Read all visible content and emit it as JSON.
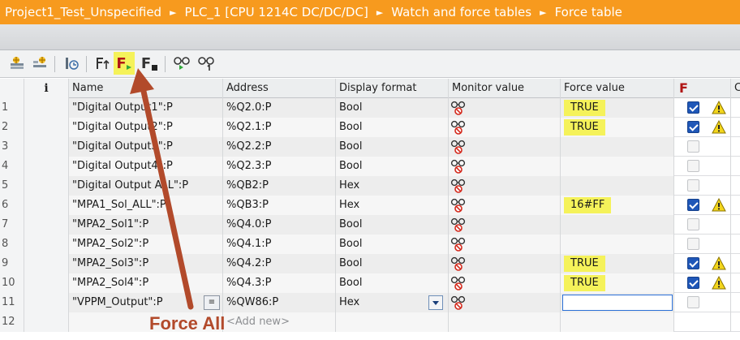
{
  "breadcrumb": [
    "Project1_Test_Unspecified",
    "PLC_1 [CPU 1214C DC/DC/DC]",
    "Watch and force tables",
    "Force table"
  ],
  "breadcrumb_separator": "►",
  "toolbar": {
    "force_once_glyph": "F",
    "stop_force_glyph": "F"
  },
  "columns": {
    "info": "i",
    "name": "Name",
    "address": "Address",
    "display_format": "Display format",
    "monitor_value": "Monitor value",
    "force_value": "Force value",
    "force_flag": "F",
    "extra": "C"
  },
  "rows": [
    {
      "num": "1",
      "name": "\"Digital Output1\":P",
      "address": "%Q2.0:P",
      "format": "Bool",
      "force": "TRUE",
      "checked": true,
      "warn": true
    },
    {
      "num": "2",
      "name": "\"Digital Output2\":P",
      "address": "%Q2.1:P",
      "format": "Bool",
      "force": "TRUE",
      "checked": true,
      "warn": true
    },
    {
      "num": "3",
      "name": "\"Digital Output3\":P",
      "address": "%Q2.2:P",
      "format": "Bool",
      "force": "",
      "checked": false,
      "warn": false
    },
    {
      "num": "4",
      "name": "\"Digital Output4\":P",
      "address": "%Q2.3:P",
      "format": "Bool",
      "force": "",
      "checked": false,
      "warn": false
    },
    {
      "num": "5",
      "name": "\"Digital Output ALL\":P",
      "address": "%QB2:P",
      "format": "Hex",
      "force": "",
      "checked": false,
      "warn": false
    },
    {
      "num": "6",
      "name": "\"MPA1_Sol_ALL\":P",
      "address": "%QB3:P",
      "format": "Hex",
      "force": "16#FF",
      "checked": true,
      "warn": true
    },
    {
      "num": "7",
      "name": "\"MPA2_Sol1\":P",
      "address": "%Q4.0:P",
      "format": "Bool",
      "force": "",
      "checked": false,
      "warn": false
    },
    {
      "num": "8",
      "name": "\"MPA2_Sol2\":P",
      "address": "%Q4.1:P",
      "format": "Bool",
      "force": "",
      "checked": false,
      "warn": false
    },
    {
      "num": "9",
      "name": "\"MPA2_Sol3\":P",
      "address": "%Q4.2:P",
      "format": "Bool",
      "force": "TRUE",
      "checked": true,
      "warn": true
    },
    {
      "num": "10",
      "name": "\"MPA2_Sol4\":P",
      "address": "%Q4.3:P",
      "format": "Bool",
      "force": "TRUE",
      "checked": true,
      "warn": true
    },
    {
      "num": "11",
      "name": "\"VPPM_Output\":P",
      "address": "%QW86:P",
      "format": "Hex",
      "force": "",
      "checked": false,
      "warn": false
    }
  ],
  "add_row": {
    "num": "12",
    "placeholder": "<Add new>"
  },
  "annotation": {
    "label": "Force All"
  },
  "colors": {
    "breadcrumb_bg": "#f79a1e",
    "highlight": "#f5f25a",
    "checkbox_on": "#1f57b8",
    "arrow": "#b24a2b"
  }
}
